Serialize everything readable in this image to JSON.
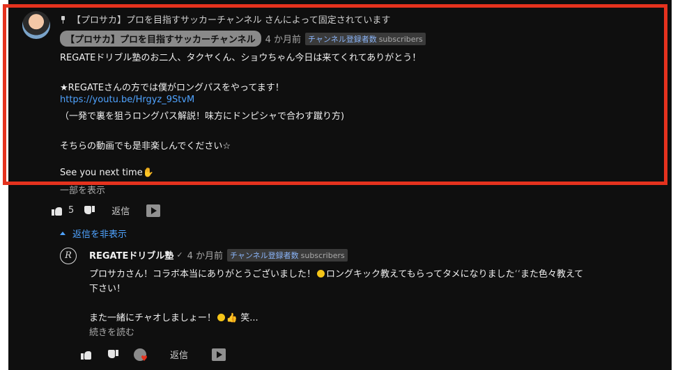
{
  "pinned": {
    "pinned_by_text": "【プロサカ】プロを目指すサッカーチャンネル さんによって固定されています",
    "author": "【プロサカ】プロを目指すサッカーチャンネル",
    "time": "4 か月前",
    "badge_text": "チャンネル登録者数",
    "badge_suffix": "subscribers",
    "lines": [
      "REGATEドリブル塾のお二人、タクヤくん、ショウちゃん今日は来てくれてありがとう！",
      "★REGATEさんの方では僕がロングパスをやってます！",
      "https://youtu.be/Hrgyz_9StvM",
      "（一発で裏を狙うロングパス解説！味方にドンピシャで合わす蹴り方)",
      "そちらの動画でも是非楽しんでください☆",
      "See you next time"
    ],
    "more_label": "一部を表示",
    "like_count": "5",
    "reply_label": "返信"
  },
  "replies_toggle": {
    "label": "返信を非表示"
  },
  "reply": {
    "avatar_letter": "R",
    "author": "REGATEドリブル塾",
    "time": "4 か月前",
    "badge_text": "チャンネル登録者数",
    "badge_suffix": "subscribers",
    "line1": "プロサカさん！コラボ本当にありがとうございました！",
    "line1b": "ロングキック教えてもらってタメになりました",
    "line1c": "また色々教えて",
    "line2": "下さい！",
    "line3": "また一緒にチャオしましょー！",
    "line3b": "笑...",
    "read_more": "続きを読む",
    "reply_label": "返信"
  },
  "colors": {
    "highlight": "#e5321e",
    "link": "#4fa3ff",
    "background": "#0f0f0f"
  },
  "icons": [
    "pin-icon",
    "thumb-up-icon",
    "thumb-down-icon",
    "reply-video-icon",
    "caret-up-icon",
    "heart-icon",
    "check-icon"
  ]
}
